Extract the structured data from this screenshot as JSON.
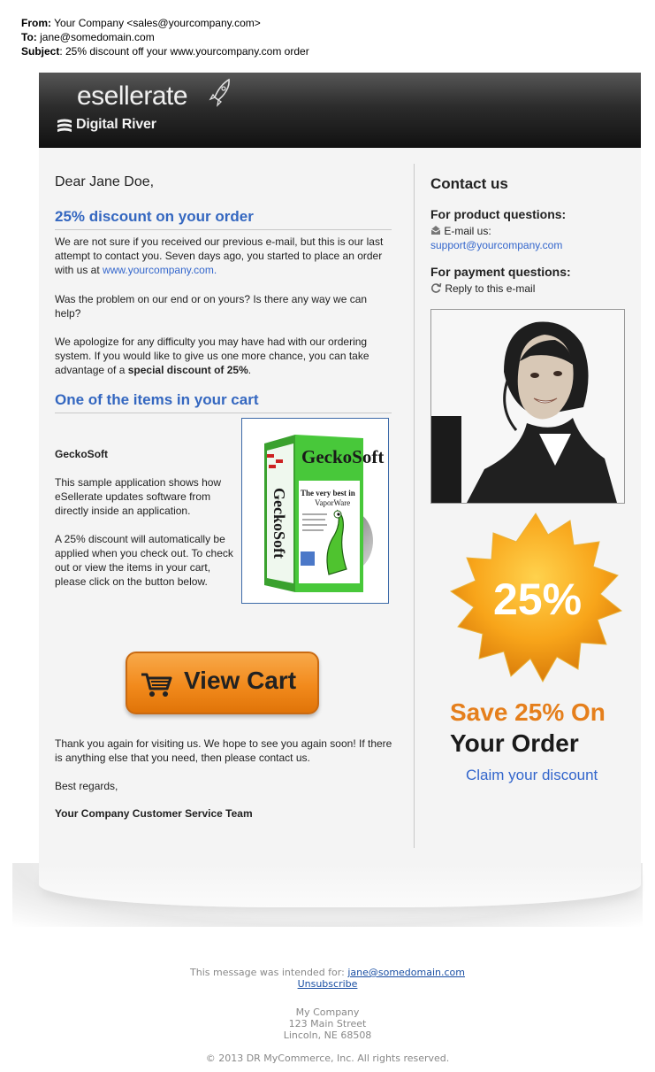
{
  "email_headers": {
    "from_label": "From:",
    "from_value": "Your Company <sales@yourcompany.com>",
    "to_label": "To:",
    "to_value": "jane@somedomain.com",
    "subject_label": "Subject",
    "subject_value": ": 25% discount off your www.yourcompany.com order"
  },
  "banner": {
    "logo_text": "esellerate",
    "brand_text": "Digital River",
    "background_color": "#1e1e1e"
  },
  "main": {
    "greeting": "Dear Jane Doe,",
    "heading1": "25% discount on your order",
    "para1_text": "We are not sure if you received our previous e-mail, but this is our last attempt to contact you. Seven days ago, you started to place an order with us at ",
    "para1_link": "www.yourcompany.com.",
    "para2": "Was the problem on our end or on yours? Is there any way we can help?",
    "para3_text": "We apologize for any difficulty you may have had with our ordering system. If you would like to give us one more chance, you can take advantage of a ",
    "para3_bold": "special discount of 25%",
    "para3_end": ".",
    "heading2": "One of the items in your cart",
    "product_name": "GeckoSoft",
    "product_desc": "This sample application shows how eSellerate updates software from directly inside an application.",
    "product_note": "A 25% discount will automatically be applied when you check out. To check out or view the items in your cart, please click on the button below.",
    "box_brand": "GeckoSoft",
    "box_tagline_1": "The very best in",
    "box_tagline_2": "VaporWare",
    "view_cart_label": "View Cart",
    "thanks": "Thank you again for visiting us. We hope to see you again soon! If there is anything else that you need, then please contact us.",
    "regards": "Best regards,",
    "signature": "Your Company Customer Service Team"
  },
  "sidebar": {
    "contact_heading": "Contact us",
    "product_questions": "For product questions:",
    "email_label": "E-mail us:",
    "email_address": "support@yourcompany.com",
    "payment_questions": "For payment questions:",
    "reply_label": "Reply to this e-mail",
    "badge_text": "25%",
    "save_line1": "Save 25% On",
    "save_line2": "Your Order",
    "claim_link": "Claim your discount"
  },
  "footer": {
    "intended_text": "This message was intended for: ",
    "intended_email": "jane@somedomain.com",
    "unsubscribe": "Unsubscribe",
    "company": "My Company",
    "street": "123 Main Street",
    "city": "Lincoln, NE 68508",
    "copyright": "© 2013 DR MyCommerce, Inc. All rights reserved."
  },
  "colors": {
    "accent_blue": "#3366cc",
    "heading_blue": "#3467c0",
    "orange": "#e57f1c",
    "panel_bg": "#f4f4f4"
  }
}
